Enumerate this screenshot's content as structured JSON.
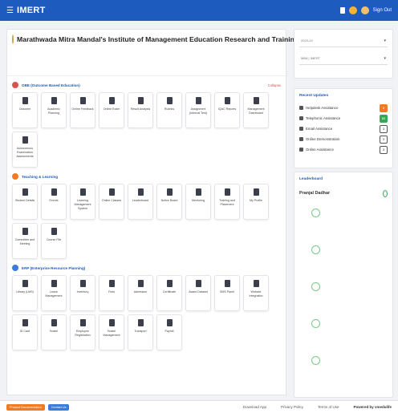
{
  "topbar": {
    "brand": "IMERT",
    "signout": "Sign Out"
  },
  "header": {
    "institute_name": "Marathwada Mitra Mandal's Institute of Management Education Research and Training (IMERT) Pune."
  },
  "sections": [
    {
      "title": "OBE (Outcome Based Education)",
      "collapse": "Collapse",
      "tiles": [
        "Outcome",
        "Academic Planning",
        "Online Feedback",
        "Online Exam",
        "Result Analysis",
        "Rubrics",
        "Assignment (Internal Test)",
        "IQAC Reports",
        "Management Dashboard",
        "Autonomous Examination Assessments"
      ]
    },
    {
      "title": "Teaching & Learning",
      "tiles": [
        "Student Details",
        "Events",
        "Learning Management System",
        "Online Classes",
        "Leaderboard",
        "Notice Board",
        "Mentoring",
        "Training and Placement",
        "My Profile",
        "Committee and Meeting",
        "Course File"
      ]
    },
    {
      "title": "ERP (Enterprise Resource Planning)",
      "tiles": [
        "Library (LMS)",
        "Leave Management",
        "Inventory",
        "Fees",
        "Admission",
        "Certificate",
        "Award Dataset",
        "SMS Panel",
        "Website Integration",
        "ID Card",
        "Hostel",
        "Employee Registration",
        "Hostel Management",
        "Transport",
        "Payroll"
      ]
    }
  ],
  "sidebar": {
    "select1": "2023-24",
    "select2": "MBA | IMERT",
    "recent_updates_title": "Recent Updates",
    "updates": [
      {
        "label": "Helpdesk Assistance",
        "badge": "0",
        "badge_color": "orange"
      },
      {
        "label": "Telephonic Assistance",
        "badge": "60",
        "badge_color": "green"
      },
      {
        "label": "Email Assistance",
        "badge": "3",
        "badge_color": "outline"
      },
      {
        "label": "Online Demonstration",
        "badge": "3",
        "badge_color": "outline"
      },
      {
        "label": "Online Assistance",
        "badge": "3",
        "badge_color": "outline"
      }
    ],
    "leaderboard_title": "Leaderboard",
    "leaderboard_top_name": "Pranjal Dadhar"
  },
  "footer": {
    "btn1": "Product Documentation",
    "btn2": "Contact Us",
    "download": "Download App",
    "privacy": "Privacy Policy",
    "terms": "Terms of Use",
    "powered": "Powered by vmedulife"
  },
  "colors": {
    "topbar": "#1e5bbf",
    "accent": "#1e5bbf",
    "orange": "#f07b24",
    "green": "#3aa655"
  }
}
